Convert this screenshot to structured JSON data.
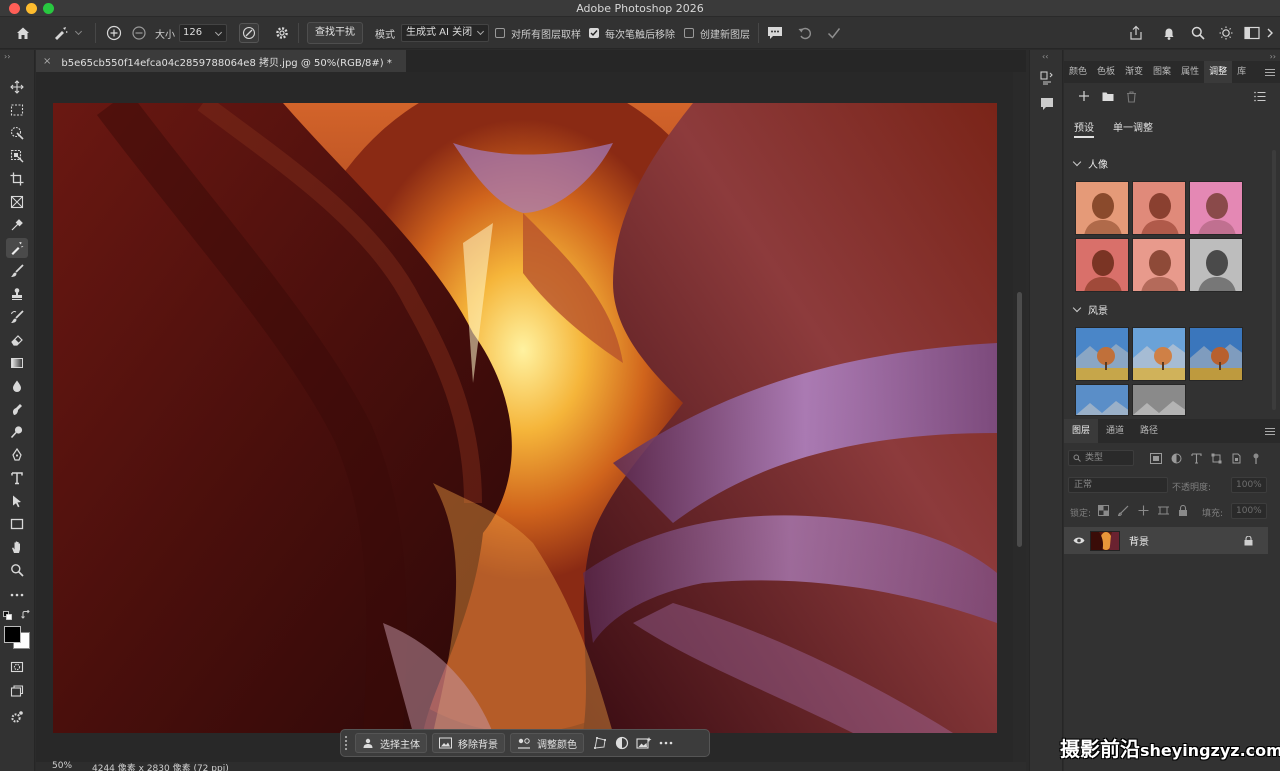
{
  "titlebar": {
    "app_title": "Adobe Photoshop 2026"
  },
  "options": {
    "size_label": "大小",
    "size_value": "126",
    "find_distractions": "查找干扰",
    "mode_label": "模式",
    "mode_value": "生成式 AI 关闭",
    "sample_all_layers": "对所有图层取样",
    "remove_after_stroke": "每次笔触后移除",
    "create_new_layer": "创建新图层"
  },
  "document": {
    "tab_title": "b5e65cb550f14efca04c2859788064e8 拷贝.jpg @ 50%(RGB/8#) *",
    "close_glyph": "×"
  },
  "taskbar": {
    "select_subject": "选择主体",
    "remove_background": "移除背景",
    "adjust_color": "调整颜色"
  },
  "status": {
    "zoom": "50%",
    "info": "4244 像素 x 2830 像素 (72 ppi)"
  },
  "adjustments_panel": {
    "tabs": [
      "颜色",
      "色板",
      "渐变",
      "图案",
      "属性",
      "调整",
      "库"
    ],
    "active_tab": "调整",
    "subtabs": [
      "预设",
      "单一调整"
    ],
    "group_portrait": "人像",
    "group_landscape": "风景"
  },
  "layers_panel": {
    "tabs": [
      "图层",
      "通道",
      "路径"
    ],
    "filter_placeholder": "类型",
    "blend_mode": "正常",
    "opacity_label": "不透明度:",
    "opacity_value": "100%",
    "lock_label": "锁定:",
    "fill_label": "填充:",
    "fill_value": "100%",
    "layer_name": "背景"
  },
  "watermark": {
    "cn": "摄影前沿",
    "url": "sheyingzyz.com"
  },
  "colors": {
    "accent": "#d9d9d9",
    "panel_bg": "#323232",
    "canvas_bg": "#282828"
  }
}
